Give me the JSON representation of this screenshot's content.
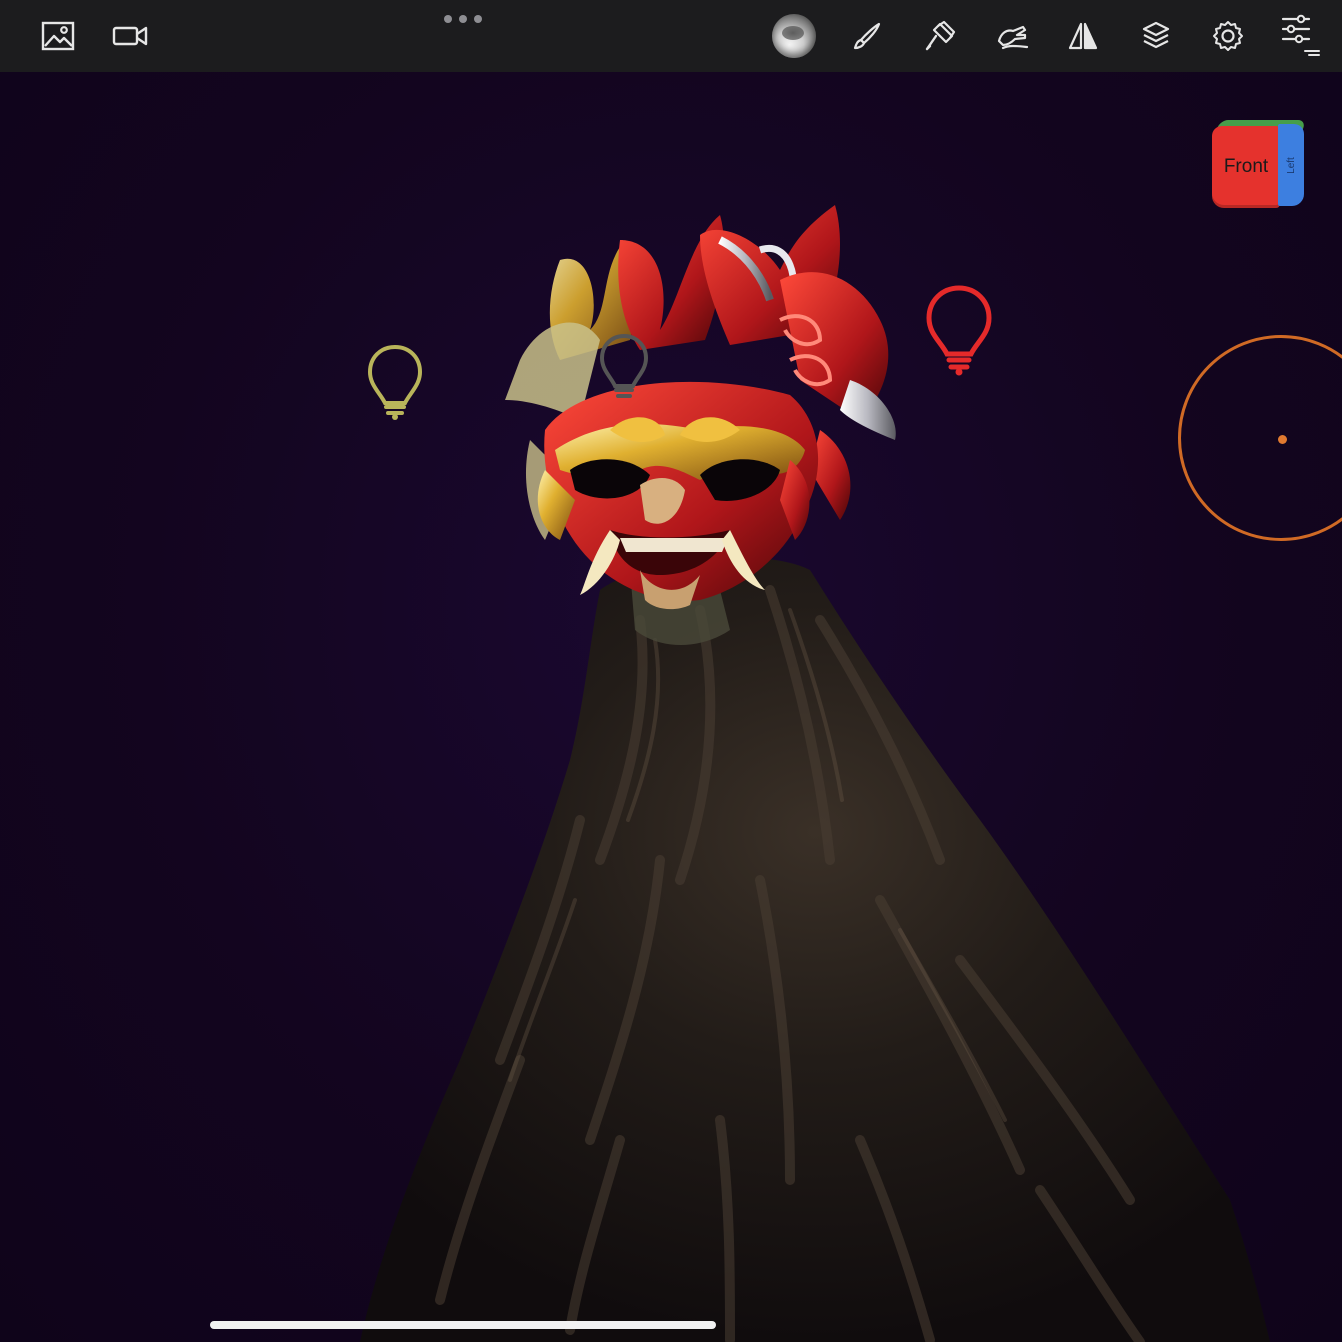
{
  "toolbar": {
    "left_buttons": [
      {
        "name": "gallery",
        "icon": "image-icon"
      },
      {
        "name": "record",
        "icon": "video-camera-icon"
      }
    ],
    "more_menu_icon": "ellipsis-icon",
    "right_buttons": [
      {
        "name": "material",
        "icon": "matcap-sphere-icon"
      },
      {
        "name": "paint",
        "icon": "brush-icon"
      },
      {
        "name": "sculpt-tool",
        "icon": "hammer-icon"
      },
      {
        "name": "stroke",
        "icon": "hand-stroke-icon"
      },
      {
        "name": "symmetry",
        "icon": "mirror-triangle-icon"
      },
      {
        "name": "scene",
        "icon": "layers-icon"
      },
      {
        "name": "settings",
        "icon": "gear-icon"
      },
      {
        "name": "interface",
        "icon": "sliders-icon"
      }
    ],
    "icon_color": "#e6e6e6"
  },
  "view_cube": {
    "front_label": "Front",
    "side_label": "Left",
    "front_color": "#e5322d",
    "side_color": "#3d7fe0",
    "top_color": "#4caf50"
  },
  "lights": [
    {
      "name": "light-yellow",
      "color": "#b9b45a"
    },
    {
      "name": "light-gray",
      "color": "#555555"
    },
    {
      "name": "light-red",
      "color": "#e52a2a"
    }
  ],
  "gizmo": {
    "color": "#d06a25"
  },
  "viewport": {
    "background": "#13051f"
  }
}
